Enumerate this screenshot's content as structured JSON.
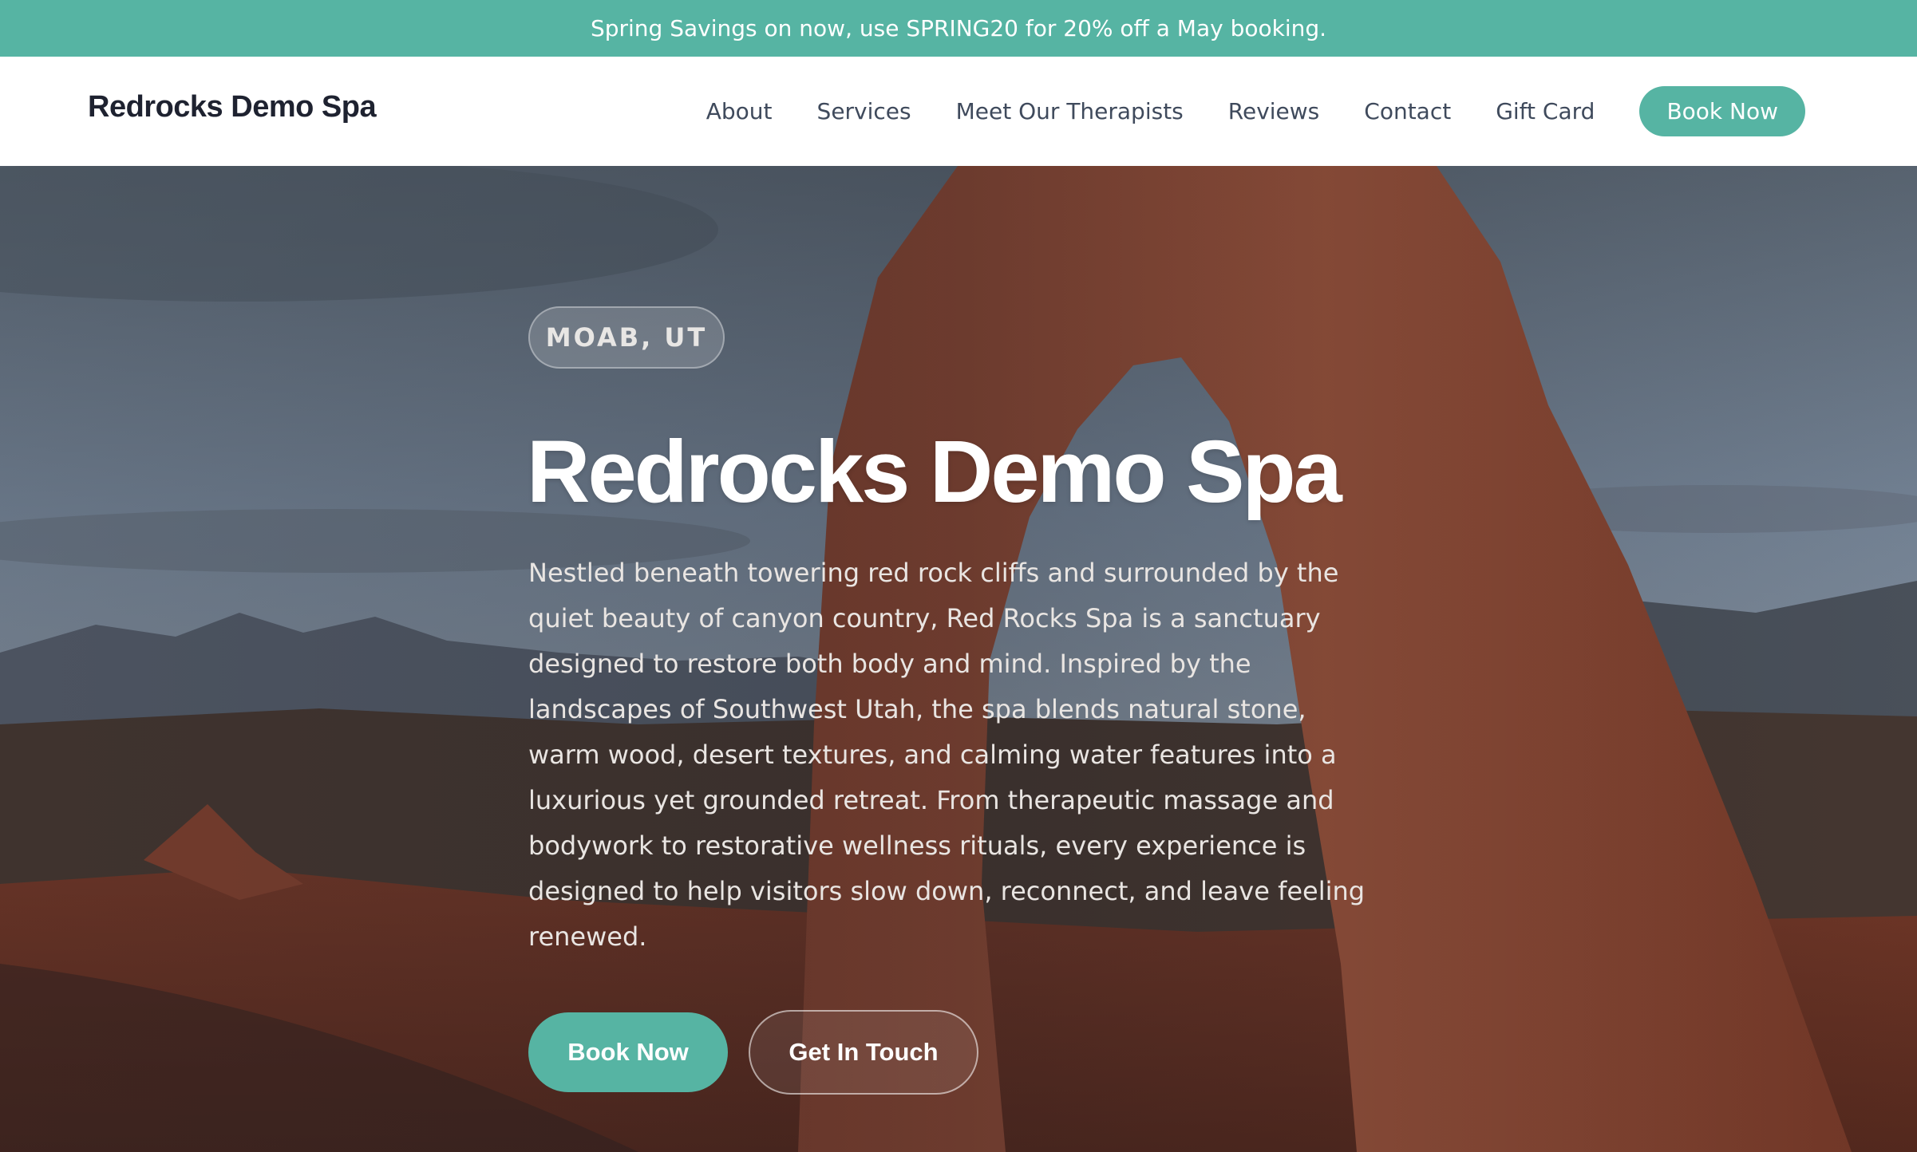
{
  "promo": {
    "text": "Spring Savings on now, use SPRING20 for 20% off a May booking."
  },
  "header": {
    "brand": "Redrocks Demo Spa",
    "nav": [
      {
        "label": "About"
      },
      {
        "label": "Services"
      },
      {
        "label": "Meet Our Therapists"
      },
      {
        "label": "Reviews"
      },
      {
        "label": "Contact"
      },
      {
        "label": "Gift Card"
      }
    ],
    "cta": "Book Now"
  },
  "hero": {
    "badge": "MOAB, UT",
    "title": "Redrocks Demo Spa",
    "description": "Nestled beneath towering red rock cliffs and surrounded by the quiet beauty of canyon country, Red Rocks Spa is a sanctuary designed to restore both body and mind. Inspired by the landscapes of Southwest Utah, the spa blends natural stone, warm wood, desert textures, and calming water features into a luxurious yet grounded retreat. From therapeutic massage and bodywork to restorative wellness rituals, every experience is designed to help visitors slow down, reconnect, and leave feeling renewed.",
    "primary_button": "Book Now",
    "secondary_button": "Get In Touch"
  },
  "colors": {
    "accent": "#56b4a3",
    "brand_text": "#1e2230",
    "nav_text": "#3f4a5c"
  }
}
